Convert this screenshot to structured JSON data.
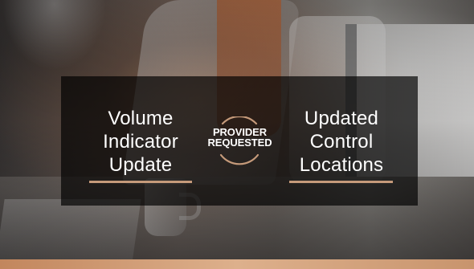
{
  "slide": {
    "left_feature": {
      "line_1": "Volume",
      "line_2": "Indicator",
      "line_3": "Update"
    },
    "center_badge": {
      "line_1": "PROVIDER",
      "line_2": "REQUESTED",
      "icon": "circular-arc-badge"
    },
    "right_feature": {
      "line_1": "Updated",
      "line_2": "Control",
      "line_3": "Locations"
    }
  },
  "colors": {
    "accent": "#c59a7a",
    "overlay": "#000000",
    "text": "#ffffff",
    "bottom_bar": "#c2865d"
  }
}
